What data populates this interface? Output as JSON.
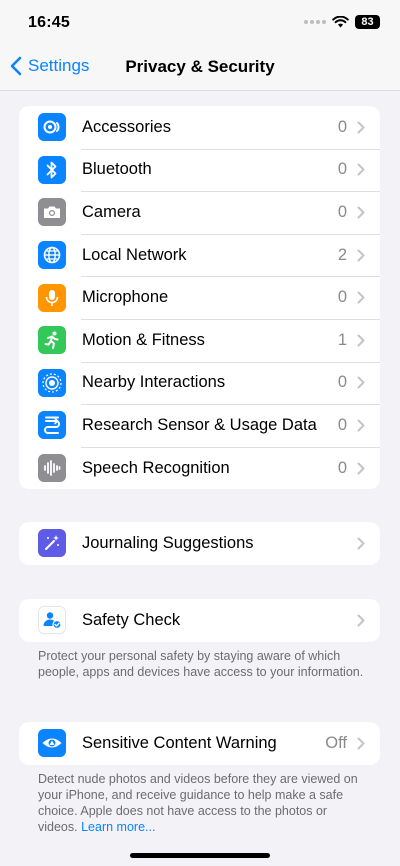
{
  "status": {
    "time": "16:45",
    "battery": "83"
  },
  "nav": {
    "back_label": "Settings",
    "title": "Privacy & Security"
  },
  "permissions": [
    {
      "label": "Accessories",
      "value": "0",
      "icon": "accessories-icon",
      "color": "#0a84ff"
    },
    {
      "label": "Bluetooth",
      "value": "0",
      "icon": "bluetooth-icon",
      "color": "#0a84ff"
    },
    {
      "label": "Camera",
      "value": "0",
      "icon": "camera-icon",
      "color": "#8e8e93"
    },
    {
      "label": "Local Network",
      "value": "2",
      "icon": "globe-icon",
      "color": "#0a84ff"
    },
    {
      "label": "Microphone",
      "value": "0",
      "icon": "microphone-icon",
      "color": "#ff9500"
    },
    {
      "label": "Motion & Fitness",
      "value": "1",
      "icon": "running-figure-icon",
      "color": "#34c759"
    },
    {
      "label": "Nearby Interactions",
      "value": "0",
      "icon": "nearby-interactions-icon",
      "color": "#0a84ff"
    },
    {
      "label": "Research Sensor & Usage Data",
      "value": "0",
      "icon": "research-sensor-icon",
      "color": "#0a84ff"
    },
    {
      "label": "Speech Recognition",
      "value": "0",
      "icon": "waveform-icon",
      "color": "#8e8e93"
    }
  ],
  "journaling": {
    "label": "Journaling Suggestions",
    "icon": "journaling-sparkle-icon",
    "color": "#5e5ce6"
  },
  "safety_check": {
    "label": "Safety Check",
    "icon": "safety-check-person-icon",
    "footer": "Protect your personal safety by staying aware of which people, apps and devices have access to your information."
  },
  "sensitive_content": {
    "label": "Sensitive Content Warning",
    "value": "Off",
    "icon": "eye-warning-icon",
    "color": "#0a84ff",
    "footer": "Detect nude photos and videos before they are viewed on your iPhone, and receive guidance to help make a safe choice. Apple does not have access to the photos or videos.",
    "link": "Learn more..."
  }
}
